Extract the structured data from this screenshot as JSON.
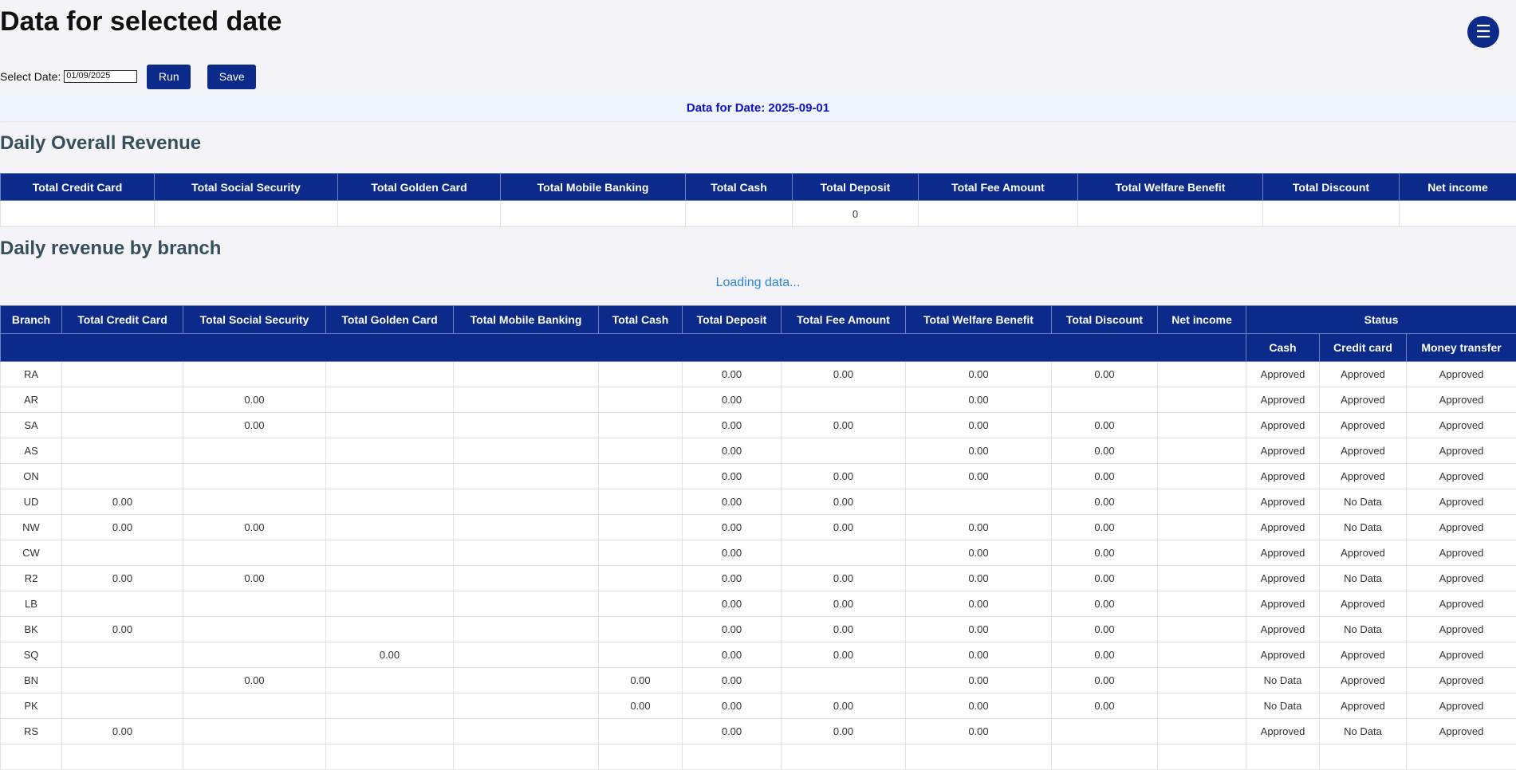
{
  "page": {
    "title": "Data for selected date",
    "menu_icon": "hamburger-menu-icon"
  },
  "controls": {
    "date_label": "Select Date:",
    "date_value": "01/09/2025",
    "run_label": "Run",
    "save_label": "Save"
  },
  "banner": "Data for Date: 2025-09-01",
  "overall": {
    "title": "Daily Overall Revenue",
    "headers": [
      "Total Credit Card",
      "Total Social Security",
      "Total Golden Card",
      "Total Mobile Banking",
      "Total Cash",
      "Total Deposit",
      "Total Fee Amount",
      "Total Welfare Benefit",
      "Total Discount",
      "Net income"
    ],
    "row": [
      "",
      "",
      "",
      "",
      "",
      "0",
      "",
      "",
      "",
      ""
    ]
  },
  "branch": {
    "title": "Daily revenue by branch",
    "loading": "Loading data...",
    "headers": [
      "Branch",
      "Total Credit Card",
      "Total Social Security",
      "Total Golden Card",
      "Total Mobile Banking",
      "Total Cash",
      "Total Deposit",
      "Total Fee Amount",
      "Total Welfare Benefit",
      "Total Discount",
      "Net income"
    ],
    "status_header": "Status",
    "status_subheaders": [
      "Cash",
      "Credit card",
      "Money transfer"
    ],
    "rows": [
      [
        "RA",
        "",
        "",
        "",
        "",
        "",
        "0.00",
        "0.00",
        "0.00",
        "0.00",
        "",
        "Approved",
        "Approved",
        "Approved"
      ],
      [
        "AR",
        "",
        "0.00",
        "",
        "",
        "",
        "0.00",
        "",
        "0.00",
        "",
        "",
        "Approved",
        "Approved",
        "Approved"
      ],
      [
        "SA",
        "",
        "0.00",
        "",
        "",
        "",
        "0.00",
        "0.00",
        "0.00",
        "0.00",
        "",
        "Approved",
        "Approved",
        "Approved"
      ],
      [
        "AS",
        "",
        "",
        "",
        "",
        "",
        "0.00",
        "",
        "0.00",
        "0.00",
        "",
        "Approved",
        "Approved",
        "Approved"
      ],
      [
        "ON",
        "",
        "",
        "",
        "",
        "",
        "0.00",
        "0.00",
        "0.00",
        "0.00",
        "",
        "Approved",
        "Approved",
        "Approved"
      ],
      [
        "UD",
        "0.00",
        "",
        "",
        "",
        "",
        "0.00",
        "0.00",
        "",
        "0.00",
        "",
        "Approved",
        "No Data",
        "Approved"
      ],
      [
        "NW",
        "0.00",
        "0.00",
        "",
        "",
        "",
        "0.00",
        "0.00",
        "0.00",
        "0.00",
        "",
        "Approved",
        "No Data",
        "Approved"
      ],
      [
        "CW",
        "",
        "",
        "",
        "",
        "",
        "0.00",
        "",
        "0.00",
        "0.00",
        "",
        "Approved",
        "Approved",
        "Approved"
      ],
      [
        "R2",
        "0.00",
        "0.00",
        "",
        "",
        "",
        "0.00",
        "0.00",
        "0.00",
        "0.00",
        "",
        "Approved",
        "No Data",
        "Approved"
      ],
      [
        "LB",
        "",
        "",
        "",
        "",
        "",
        "0.00",
        "0.00",
        "0.00",
        "0.00",
        "",
        "Approved",
        "Approved",
        "Approved"
      ],
      [
        "BK",
        "0.00",
        "",
        "",
        "",
        "",
        "0.00",
        "0.00",
        "0.00",
        "0.00",
        "",
        "Approved",
        "No Data",
        "Approved"
      ],
      [
        "SQ",
        "",
        "",
        "0.00",
        "",
        "",
        "0.00",
        "0.00",
        "0.00",
        "0.00",
        "",
        "Approved",
        "Approved",
        "Approved"
      ],
      [
        "BN",
        "",
        "0.00",
        "",
        "",
        "0.00",
        "0.00",
        "",
        "0.00",
        "0.00",
        "",
        "No Data",
        "Approved",
        "Approved"
      ],
      [
        "PK",
        "",
        "",
        "",
        "",
        "0.00",
        "0.00",
        "0.00",
        "0.00",
        "0.00",
        "",
        "No Data",
        "Approved",
        "Approved"
      ],
      [
        "RS",
        "0.00",
        "",
        "",
        "",
        "",
        "0.00",
        "0.00",
        "0.00",
        "",
        "",
        "Approved",
        "No Data",
        "Approved"
      ],
      [
        "",
        "",
        "",
        "",
        "",
        "",
        "",
        "",
        "",
        "",
        "",
        "",
        "",
        ""
      ]
    ]
  }
}
